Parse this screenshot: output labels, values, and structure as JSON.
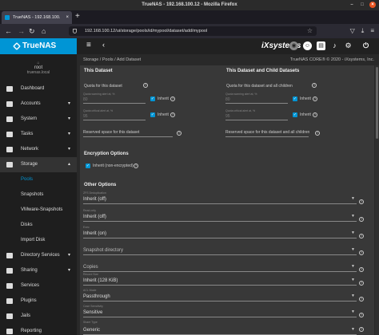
{
  "browser": {
    "window_title": "TrueNAS - 192.168.100.12 - Mozilla Firefox",
    "tab_title": "TrueNAS - 192.168.100.",
    "url": "192.168.100.12/ui/storage/pools/id/mypool/dataset/add/mypool"
  },
  "app": {
    "logo": "TrueNAS",
    "vendor": "iXsystems",
    "user": "root",
    "host": "truenas.local"
  },
  "sidebar": {
    "items": [
      {
        "label": "Dashboard",
        "icon": "dashboard-icon"
      },
      {
        "label": "Accounts",
        "icon": "accounts-icon",
        "expand": "▾"
      },
      {
        "label": "System",
        "icon": "system-icon",
        "expand": "▾"
      },
      {
        "label": "Tasks",
        "icon": "tasks-icon",
        "expand": "▾"
      },
      {
        "label": "Network",
        "icon": "network-icon",
        "expand": "▾"
      },
      {
        "label": "Storage",
        "icon": "storage-icon",
        "expand": "▴"
      }
    ],
    "storage_sub": [
      "Pools",
      "Snapshots",
      "VMware-Snapshots",
      "Disks",
      "Import Disk"
    ],
    "items2": [
      {
        "label": "Directory Services",
        "icon": "directory-services-icon",
        "expand": "▾"
      },
      {
        "label": "Sharing",
        "icon": "sharing-icon",
        "expand": "▾"
      },
      {
        "label": "Services",
        "icon": "services-icon"
      },
      {
        "label": "Plugins",
        "icon": "plugins-icon"
      },
      {
        "label": "Jails",
        "icon": "jails-icon"
      },
      {
        "label": "Reporting",
        "icon": "reporting-icon"
      }
    ]
  },
  "breadcrumb": {
    "path": "Storage  /  Pools  /  Add Dataset",
    "copyright": "TrueNAS CORE® © 2020 - iXsystems, Inc."
  },
  "form": {
    "this_dataset": {
      "title": "This Dataset",
      "quota_label": "Quota for this dataset",
      "warn_label": "Quota warning alert at, %",
      "warn_value": "80",
      "crit_label": "Quota critical alert at, %",
      "crit_value": "95",
      "inherit": "Inherit",
      "reserved_label": "Reserved space for this dataset"
    },
    "children": {
      "title": "This Dataset and Child Datasets",
      "quota_label": "Quota for this dataset and all children",
      "warn_label": "Quota warning alert at, %",
      "warn_value": "80",
      "crit_label": "Quota critical alert at, %",
      "crit_value": "95",
      "inherit": "Inherit",
      "reserved_label": "Reserved space for this dataset and all children"
    },
    "encryption": {
      "title": "Encryption Options",
      "inherit_label": "Inherit (non-encrypted)"
    },
    "other": {
      "title": "Other Options",
      "fields": [
        {
          "placeholder": "ZFS Deduplication",
          "value": "Inherit (off)"
        },
        {
          "placeholder": "Read-only",
          "value": "Inherit (off)"
        },
        {
          "placeholder": "Exec",
          "value": "Inherit (on)"
        },
        {
          "placeholder": "",
          "value": "Snapshot directory"
        },
        {
          "placeholder": "",
          "value": "Copies"
        },
        {
          "placeholder": "Record Size",
          "value": "Inherit (128 KiB)"
        },
        {
          "placeholder": "ACL Mode",
          "value": "Passthrough"
        },
        {
          "placeholder": "Case Sensitivity",
          "value": "Sensitive"
        },
        {
          "placeholder": "Share Type",
          "value": "Generic"
        }
      ]
    }
  }
}
